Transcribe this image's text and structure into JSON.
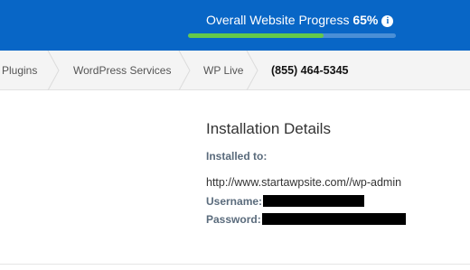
{
  "header": {
    "progress_label": "Overall Website Progress",
    "progress_value_text": "65%",
    "progress_fraction": 0.65,
    "info_icon": "info-icon",
    "colors": {
      "bar_bg": "#0866c6",
      "progress_fill": "#64c94a"
    }
  },
  "breadcrumb": {
    "items": [
      "Plugins",
      "WordPress Services",
      "WP Live"
    ],
    "phone": "(855) 464-5345"
  },
  "details": {
    "title": "Installation Details",
    "installed_label": "Installed to:",
    "url": "http://www.startawpsite.com//wp-admin",
    "username_label": "Username:",
    "password_label": "Password:"
  }
}
